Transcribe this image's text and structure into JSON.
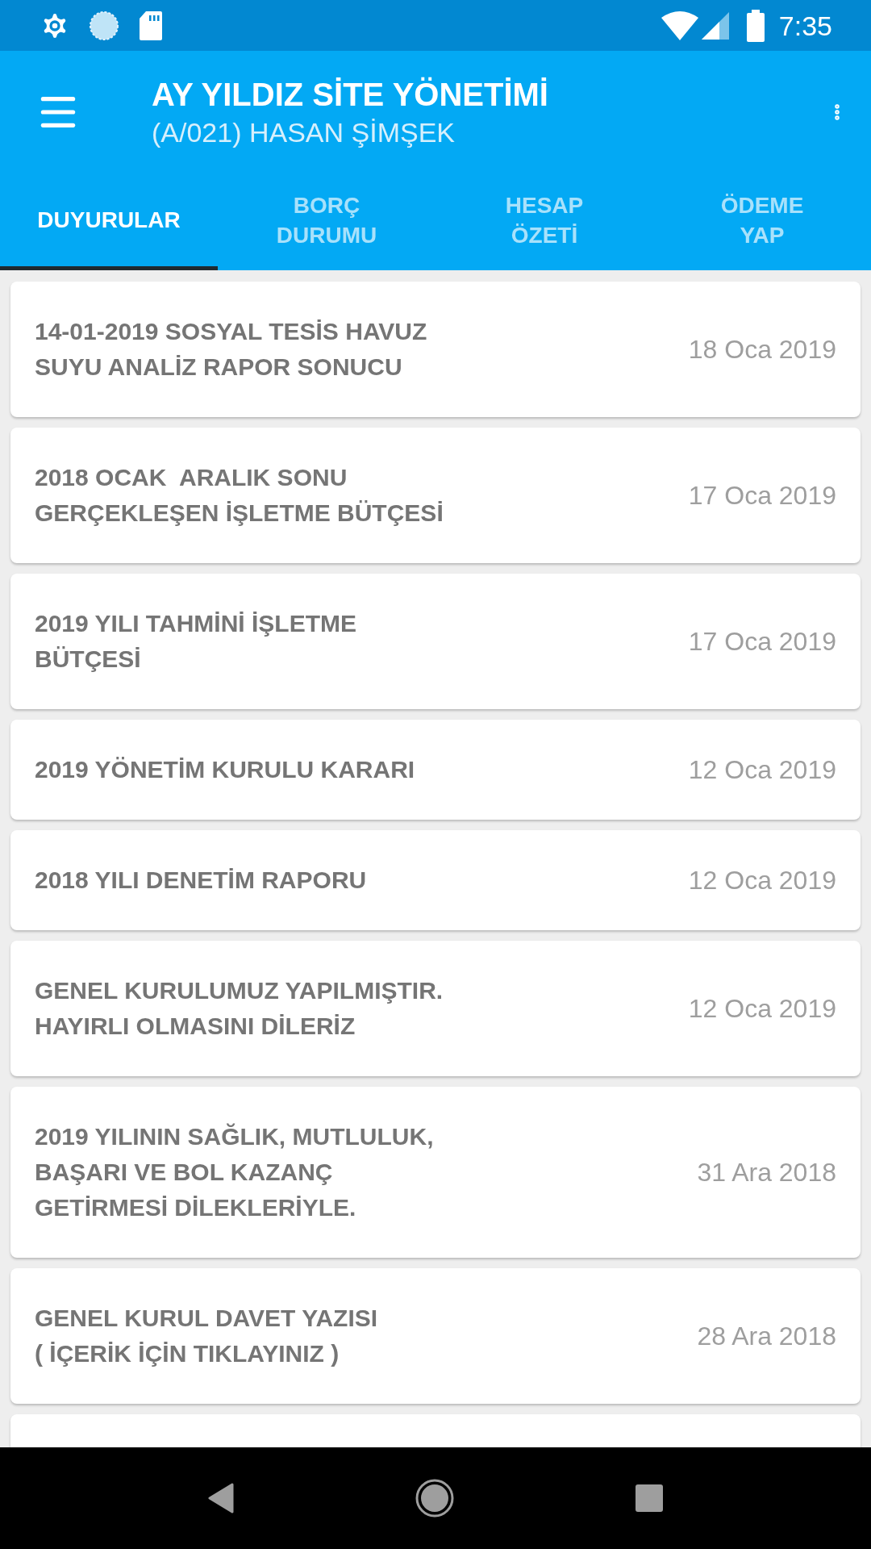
{
  "status_bar": {
    "time": "7:35"
  },
  "toolbar": {
    "title": "AY YILDIZ SİTE YÖNETİMİ",
    "subtitle": "(A/021) HASAN ŞİMŞEK"
  },
  "tabs": [
    {
      "label": "DUYURULAR",
      "selected": true
    },
    {
      "label": "BORÇ\nDURUMU",
      "selected": false
    },
    {
      "label": "HESAP\nÖZETİ",
      "selected": false
    },
    {
      "label": "ÖDEME\nYAP",
      "selected": false
    }
  ],
  "announcements": [
    {
      "title": "14-01-2019 SOSYAL TESİS HAVUZ\nSUYU ANALİZ RAPOR SONUCU",
      "date": "18 Oca 2019"
    },
    {
      "title": "2018 OCAK  ARALIK SONU\nGERÇEKLEŞEN İŞLETME BÜTÇESİ",
      "date": "17 Oca 2019"
    },
    {
      "title": "2019 YILI TAHMİNİ İŞLETME\nBÜTÇESİ",
      "date": "17 Oca 2019"
    },
    {
      "title": "2019 YÖNETİM KURULU KARARI",
      "date": "12 Oca 2019"
    },
    {
      "title": "2018 YILI DENETİM RAPORU",
      "date": "12 Oca 2019"
    },
    {
      "title": "GENEL KURULUMUZ YAPILMIŞTIR.\nHAYIRLI OLMASINI DİLERİZ",
      "date": "12 Oca 2019"
    },
    {
      "title": "2019 YILININ SAĞLIK, MUTLULUK,\nBAŞARI VE BOL KAZANÇ\nGETİRMESİ DİLEKLERİYLE.",
      "date": "31 Ara 2018"
    },
    {
      "title": "GENEL KURUL DAVET YAZISI\n( İÇERİK İÇİN TIKLAYINIZ )",
      "date": "28 Ara 2018"
    }
  ]
}
